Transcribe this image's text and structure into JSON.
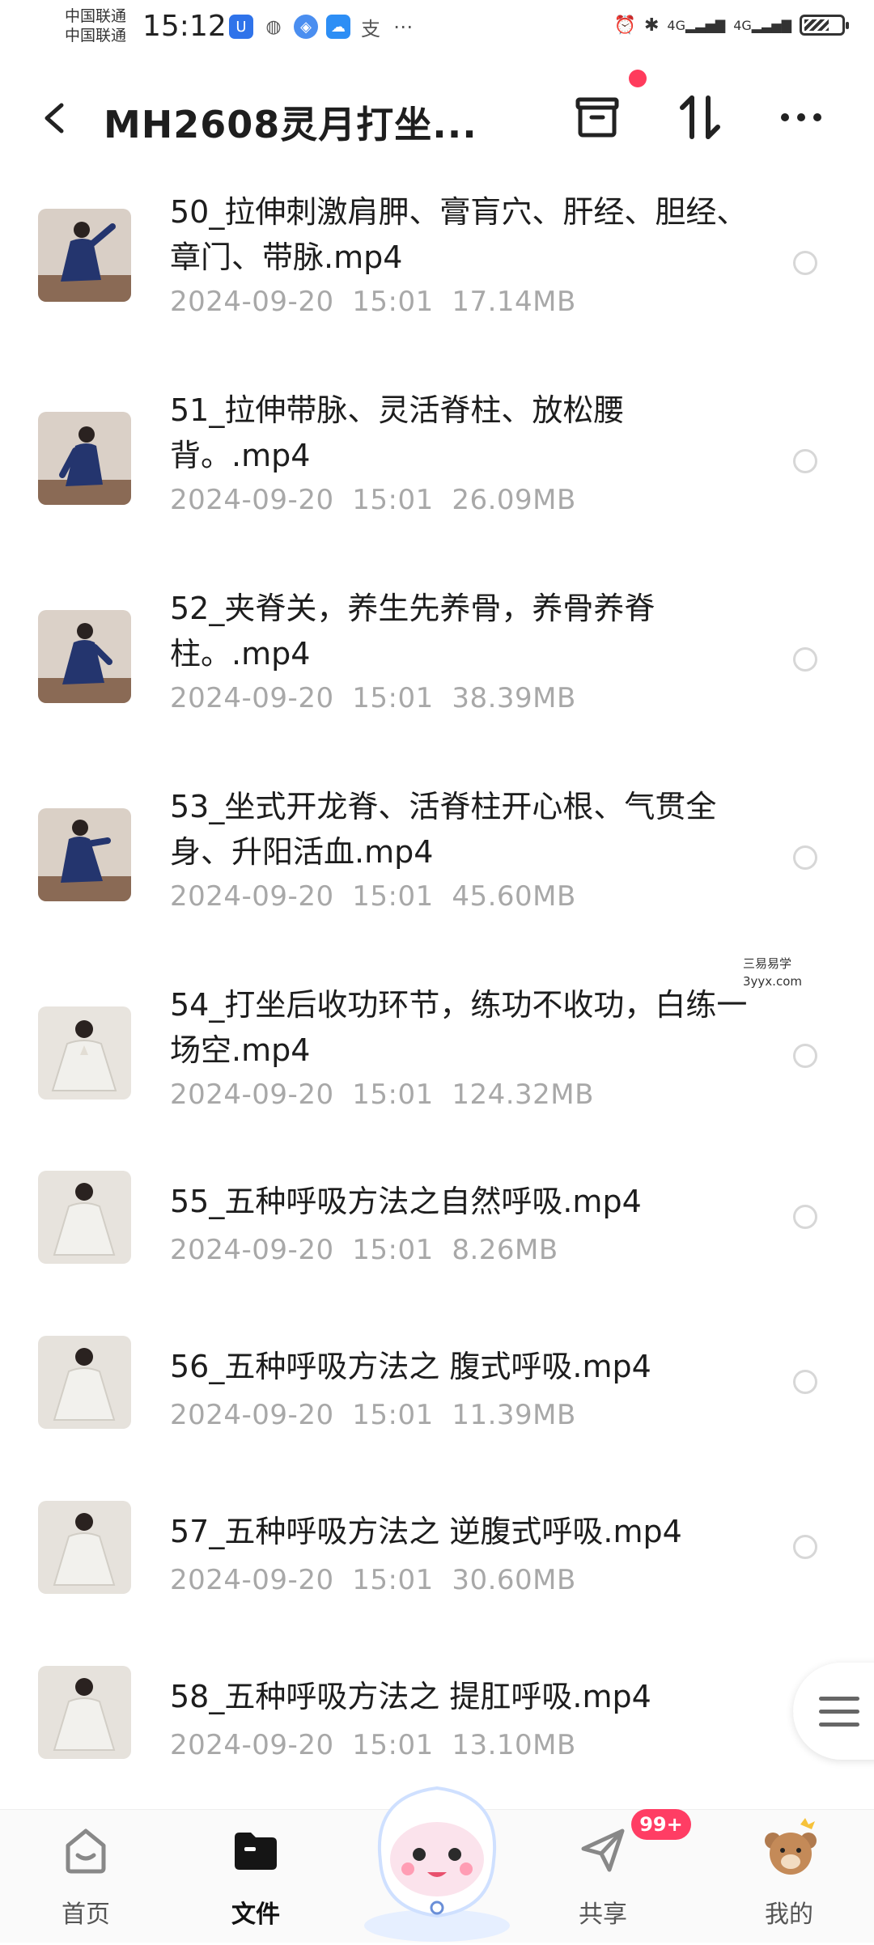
{
  "status_bar": {
    "carrier1": "中国联通",
    "carrier2": "中国联通",
    "time": "15:12",
    "network": "4G"
  },
  "header": {
    "title": "MH2608灵月打坐...",
    "back_icon": "chevron-left-icon",
    "actions": [
      "archive-icon",
      "sort-icon",
      "more-icon"
    ]
  },
  "files": [
    {
      "title": "50_拉伸刺激肩胛、膏肓穴、肝经、胆经、章门、带脉.mp4",
      "date": "2024-09-20",
      "time": "15:01",
      "size": "17.14MB"
    },
    {
      "title": "51_拉伸带脉、灵活脊柱、放松腰背。.mp4",
      "date": "2024-09-20",
      "time": "15:01",
      "size": "26.09MB"
    },
    {
      "title": "52_夹脊关，养生先养骨，养骨养脊柱。.mp4",
      "date": "2024-09-20",
      "time": "15:01",
      "size": "38.39MB"
    },
    {
      "title": "53_坐式开龙脊、活脊柱开心根、气贯全身、升阳活血.mp4",
      "date": "2024-09-20",
      "time": "15:01",
      "size": "45.60MB"
    },
    {
      "title": "54_打坐后收功环节，练功不收功，白练一场空.mp4",
      "date": "2024-09-20",
      "time": "15:01",
      "size": "124.32MB"
    },
    {
      "title": "55_五种呼吸方法之自然呼吸.mp4",
      "date": "2024-09-20",
      "time": "15:01",
      "size": "8.26MB"
    },
    {
      "title": "56_五种呼吸方法之 腹式呼吸.mp4",
      "date": "2024-09-20",
      "time": "15:01",
      "size": "11.39MB"
    },
    {
      "title": "57_五种呼吸方法之 逆腹式呼吸.mp4",
      "date": "2024-09-20",
      "time": "15:01",
      "size": "30.60MB"
    },
    {
      "title": "58_五种呼吸方法之 提肛呼吸.mp4",
      "date": "2024-09-20",
      "time": "15:01",
      "size": "13.10MB"
    }
  ],
  "watermark": {
    "line1": "三易易学",
    "line2": "3yyx.com"
  },
  "bottom_nav": {
    "home": "首页",
    "files": "文件",
    "share": "共享",
    "mine": "我的",
    "share_badge": "99+"
  },
  "colors": {
    "accent_red": "#ff3d64",
    "robe_blue": "#24356e",
    "robe_white": "#eeeeea"
  }
}
